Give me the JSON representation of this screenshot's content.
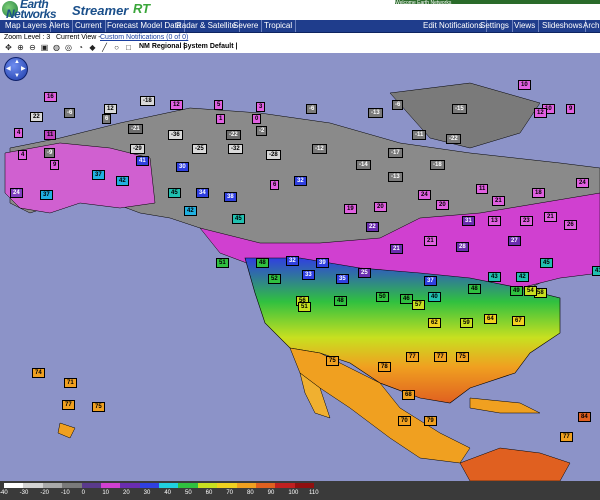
{
  "header": {
    "logo_line1": "Earth",
    "logo_line2": "Networks",
    "product": "Streamer",
    "product_rt": "RT",
    "welcome": "Welcome Earth Networks"
  },
  "menu": {
    "left": [
      "Map Layers",
      "Alerts",
      "Current",
      "Forecast Model Data",
      "Radar & Satellite",
      "Severe",
      "Tropical"
    ],
    "right": [
      "Edit Notifications",
      "Settings",
      "Views",
      "Slideshows",
      "Arch"
    ]
  },
  "zoom": {
    "zoom_level": "Zoom Level : 3",
    "current_view": "Current View -",
    "custom_notifications": "Custom Notifications (0 of 0)"
  },
  "toolbar": {
    "nm_regional": "NM Regional  |",
    "system_default": "System Default  |"
  },
  "icons": [
    "pan-icon",
    "zoom-in-icon",
    "zoom-out-icon",
    "globe-icon",
    "eraser-icon",
    "line-icon",
    "circle-icon",
    "square-icon",
    "compass-icon"
  ],
  "legend": {
    "labels": [
      "-40",
      "-30",
      "-20",
      "-10",
      "0",
      "10",
      "20",
      "30",
      "40",
      "50",
      "60",
      "70",
      "80",
      "90",
      "100",
      "110"
    ],
    "colors": [
      "#ffffff",
      "#d4d4d4",
      "#aaaaaa",
      "#7a7a7a",
      "#5a3a8c",
      "#d040d0",
      "#6a2db0",
      "#3040e0",
      "#20d0e0",
      "#30c040",
      "#c8e020",
      "#f0d020",
      "#f0a020",
      "#e06020",
      "#c02020",
      "#901010"
    ]
  },
  "map": {
    "temps": [
      {
        "v": "16",
        "c": "#e060e0"
      },
      {
        "v": "12",
        "c": "#d9d9d9"
      },
      {
        "v": "-18",
        "c": "#d9d9d9"
      },
      {
        "v": "12",
        "c": "#e060e0"
      },
      {
        "v": "5",
        "c": "#e060e0"
      },
      {
        "v": "3",
        "c": "#e060e0"
      },
      {
        "v": "22",
        "c": "#d9d9d9"
      },
      {
        "v": "-6",
        "c": "#7a7a7a"
      },
      {
        "v": "6",
        "c": "#7a7a7a"
      },
      {
        "v": "-21",
        "c": "#6d6d6d"
      },
      {
        "v": "1",
        "c": "#e060e0"
      },
      {
        "v": "0",
        "c": "#e060e0"
      },
      {
        "v": "4",
        "c": "#e060e0"
      },
      {
        "v": "11",
        "c": "#c040c0"
      },
      {
        "v": "-36",
        "c": "#d9d9d9"
      },
      {
        "v": "-22",
        "c": "#6d6d6d"
      },
      {
        "v": "-2",
        "c": "#7a7a7a"
      },
      {
        "v": "4",
        "c": "#e060e0"
      },
      {
        "v": "-9",
        "c": "#7a7a7a"
      },
      {
        "v": "-29",
        "c": "#d9d9d9"
      },
      {
        "v": "-25",
        "c": "#d9d9d9"
      },
      {
        "v": "-32",
        "c": "#d9d9d9"
      },
      {
        "v": "-28",
        "c": "#d9d9d9"
      },
      {
        "v": "-12",
        "c": "#7a7a7a"
      },
      {
        "v": "9",
        "c": "#e060e0"
      },
      {
        "v": "41",
        "c": "#3040e0"
      },
      {
        "v": "30",
        "c": "#3040e0"
      },
      {
        "v": "37",
        "c": "#20b0e0"
      },
      {
        "v": "42",
        "c": "#20b0e0"
      },
      {
        "v": "24",
        "c": "#8040c0"
      },
      {
        "v": "37",
        "c": "#20b0e0"
      },
      {
        "v": "45",
        "c": "#20c0b0"
      },
      {
        "v": "34",
        "c": "#3040e0"
      },
      {
        "v": "38",
        "c": "#3040e0"
      },
      {
        "v": "42",
        "c": "#20b0e0"
      },
      {
        "v": "45",
        "c": "#20c0b0"
      },
      {
        "v": "-6",
        "c": "#7a7a7a"
      },
      {
        "v": "-13",
        "c": "#7a7a7a"
      },
      {
        "v": "-6",
        "c": "#7a7a7a"
      },
      {
        "v": "-15",
        "c": "#7a7a7a"
      },
      {
        "v": "-11",
        "c": "#7a7a7a"
      },
      {
        "v": "-22",
        "c": "#7a7a7a"
      },
      {
        "v": "-17",
        "c": "#7a7a7a"
      },
      {
        "v": "-14",
        "c": "#7a7a7a"
      },
      {
        "v": "-18",
        "c": "#7a7a7a"
      },
      {
        "v": "-13",
        "c": "#7a7a7a"
      },
      {
        "v": "10",
        "c": "#e060e0"
      },
      {
        "v": "10",
        "c": "#e060e0"
      },
      {
        "v": "9",
        "c": "#e060e0"
      },
      {
        "v": "12",
        "c": "#e060e0"
      },
      {
        "v": "11",
        "c": "#e060e0"
      },
      {
        "v": "18",
        "c": "#e060e0"
      },
      {
        "v": "21",
        "c": "#e060e0"
      },
      {
        "v": "20",
        "c": "#e060e0"
      },
      {
        "v": "23",
        "c": "#e060e0"
      },
      {
        "v": "21",
        "c": "#e060e0"
      },
      {
        "v": "26",
        "c": "#e060e0"
      },
      {
        "v": "24",
        "c": "#e060e0"
      },
      {
        "v": "32",
        "c": "#3040e0"
      },
      {
        "v": "6",
        "c": "#e060e0"
      },
      {
        "v": "19",
        "c": "#e060e0"
      },
      {
        "v": "20",
        "c": "#e060e0"
      },
      {
        "v": "24",
        "c": "#e060e0"
      },
      {
        "v": "13",
        "c": "#e060e0"
      },
      {
        "v": "21",
        "c": "#e060e0"
      },
      {
        "v": "31",
        "c": "#6a2db0"
      },
      {
        "v": "27",
        "c": "#6a2db0"
      },
      {
        "v": "51",
        "c": "#30c040"
      },
      {
        "v": "48",
        "c": "#30c040"
      },
      {
        "v": "32",
        "c": "#3040e0"
      },
      {
        "v": "39",
        "c": "#3040e0"
      },
      {
        "v": "22",
        "c": "#6a2db0"
      },
      {
        "v": "21",
        "c": "#6a2db0"
      },
      {
        "v": "28",
        "c": "#6a2db0"
      },
      {
        "v": "45",
        "c": "#20c0b0"
      },
      {
        "v": "41",
        "c": "#20c0b0"
      },
      {
        "v": "52",
        "c": "#30c040"
      },
      {
        "v": "33",
        "c": "#3040e0"
      },
      {
        "v": "35",
        "c": "#3040e0"
      },
      {
        "v": "25",
        "c": "#6a2db0"
      },
      {
        "v": "37",
        "c": "#3040e0"
      },
      {
        "v": "43",
        "c": "#20c0b0"
      },
      {
        "v": "49",
        "c": "#30c040"
      },
      {
        "v": "42",
        "c": "#20c0b0"
      },
      {
        "v": "56",
        "c": "#c8e020"
      },
      {
        "v": "48",
        "c": "#30c040"
      },
      {
        "v": "50",
        "c": "#30c040"
      },
      {
        "v": "46",
        "c": "#30c040"
      },
      {
        "v": "40",
        "c": "#20c0b0"
      },
      {
        "v": "48",
        "c": "#30c040"
      },
      {
        "v": "58",
        "c": "#c8e020"
      },
      {
        "v": "54",
        "c": "#c8e020"
      },
      {
        "v": "51",
        "c": "#c8e020"
      },
      {
        "v": "57",
        "c": "#c8e020"
      },
      {
        "v": "62",
        "c": "#f0d020"
      },
      {
        "v": "59",
        "c": "#c8e020"
      },
      {
        "v": "64",
        "c": "#f0d020"
      },
      {
        "v": "67",
        "c": "#f0d020"
      },
      {
        "v": "75",
        "c": "#f0a020"
      },
      {
        "v": "77",
        "c": "#f0a020"
      },
      {
        "v": "77",
        "c": "#f0a020"
      },
      {
        "v": "75",
        "c": "#f0a020"
      },
      {
        "v": "78",
        "c": "#f0a020"
      },
      {
        "v": "68",
        "c": "#f0a020"
      },
      {
        "v": "74",
        "c": "#f0a020"
      },
      {
        "v": "71",
        "c": "#f0a020"
      },
      {
        "v": "77",
        "c": "#f0a020"
      },
      {
        "v": "75",
        "c": "#f0a020"
      },
      {
        "v": "70",
        "c": "#f0a020"
      },
      {
        "v": "79",
        "c": "#f0a020"
      },
      {
        "v": "84",
        "c": "#e06020"
      },
      {
        "v": "77",
        "c": "#f0a020"
      }
    ]
  }
}
